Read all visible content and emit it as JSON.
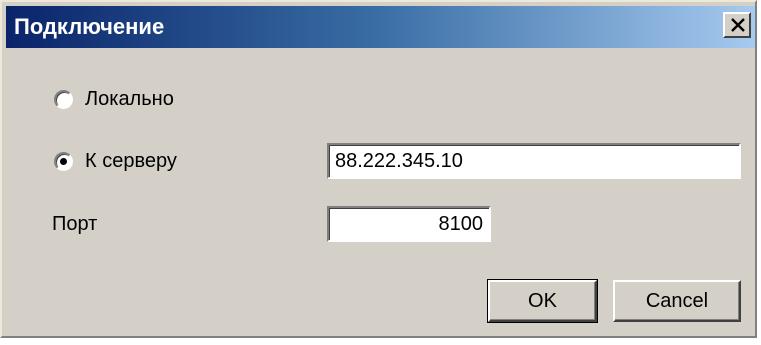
{
  "window": {
    "title": "Подключение",
    "close_icon": "close-icon"
  },
  "connection": {
    "local_label": "Локально",
    "local_selected": false,
    "server_label": "К серверу",
    "server_selected": true,
    "server_address": "88.222.345.10",
    "port_label": "Порт",
    "port_value": "8100"
  },
  "buttons": {
    "ok_label": "OK",
    "cancel_label": "Cancel"
  },
  "colors": {
    "dialog_bg": "#d4d0c8",
    "title_gradient_start": "#0a246a",
    "title_gradient_end": "#a6caf0",
    "title_text": "#ffffff"
  }
}
